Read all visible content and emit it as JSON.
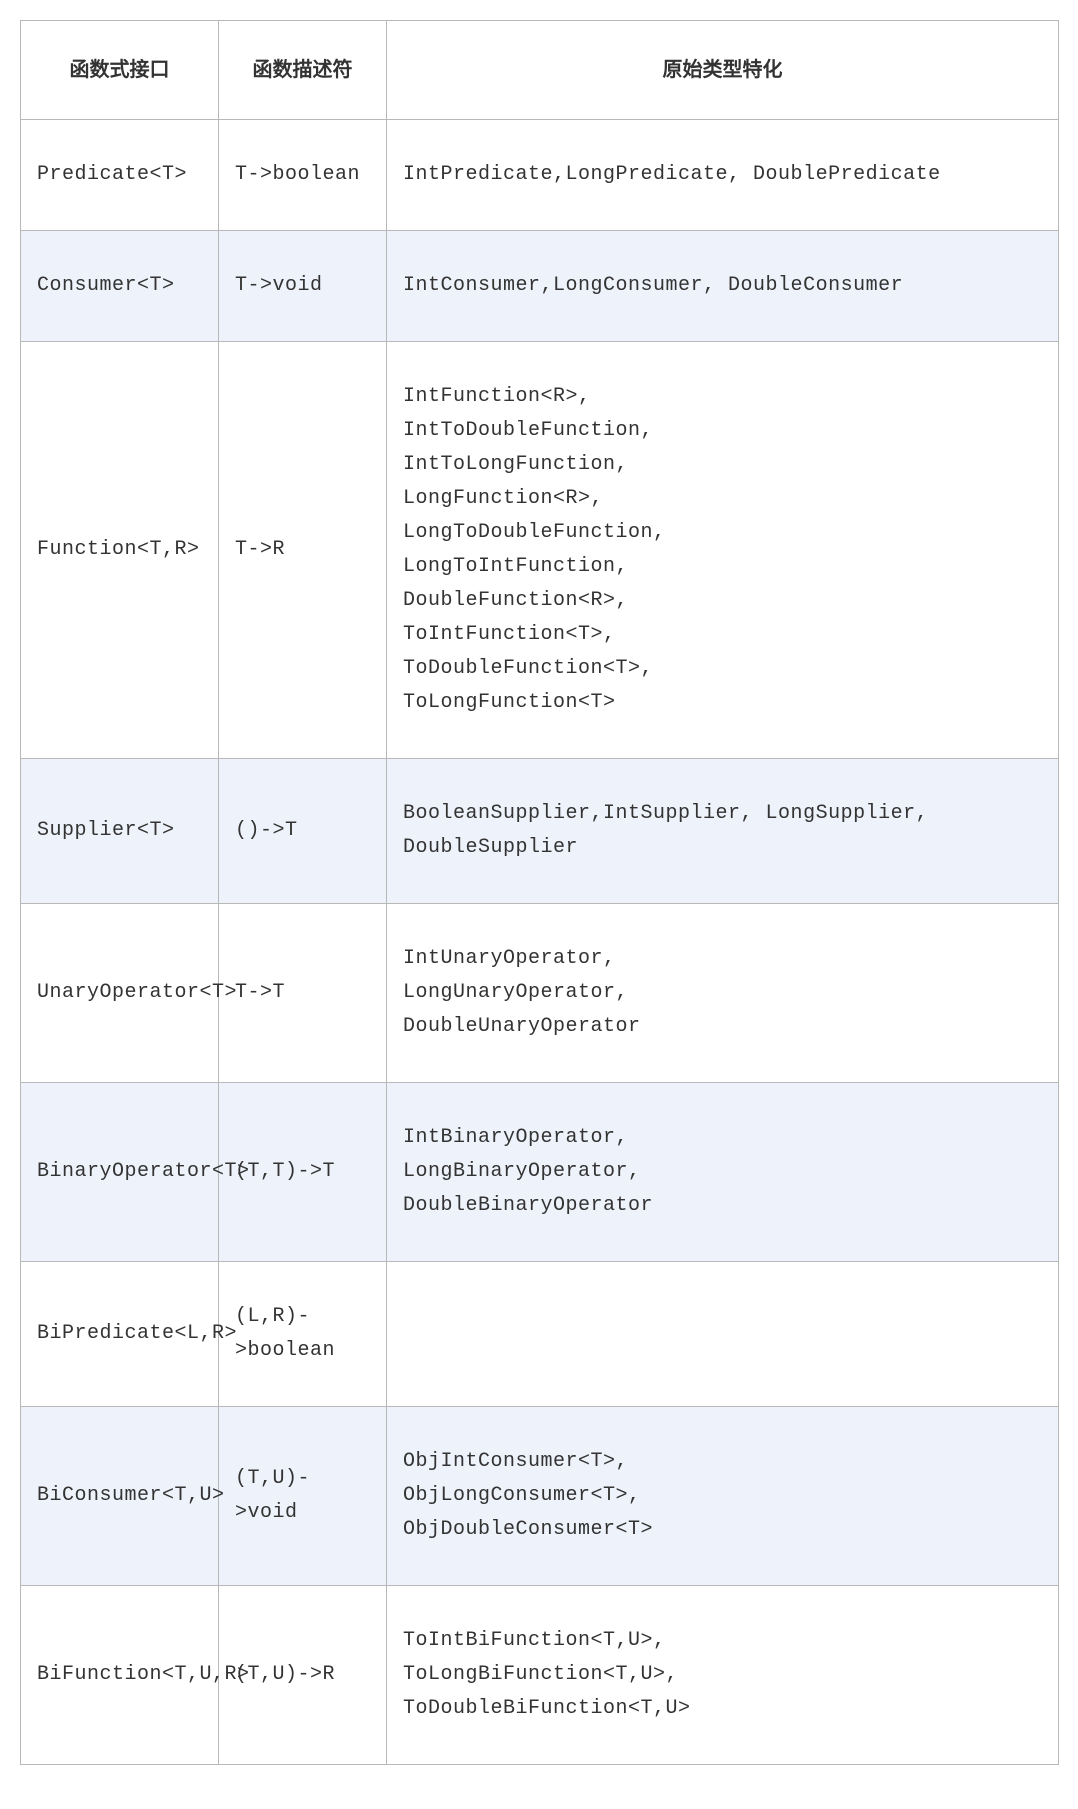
{
  "headers": {
    "interface": "函数式接口",
    "descriptor": "函数描述符",
    "specialization": "原始类型特化"
  },
  "rows": [
    {
      "interface": "Predicate<T>",
      "descriptor": "T->boolean",
      "specialization": "IntPredicate,LongPredicate, DoublePredicate",
      "striped": false
    },
    {
      "interface": "Consumer<T>",
      "descriptor": "T->void",
      "specialization": "IntConsumer,LongConsumer, DoubleConsumer",
      "striped": true
    },
    {
      "interface": "Function<T,R>",
      "descriptor": "T->R",
      "specialization": "IntFunction<R>,\nIntToDoubleFunction,\nIntToLongFunction,\nLongFunction<R>,\nLongToDoubleFunction,\nLongToIntFunction,\nDoubleFunction<R>,\nToIntFunction<T>,\nToDoubleFunction<T>,\nToLongFunction<T>",
      "striped": false
    },
    {
      "interface": "Supplier<T>",
      "descriptor": "()->T",
      "specialization": "BooleanSupplier,IntSupplier, LongSupplier, DoubleSupplier",
      "striped": true
    },
    {
      "interface": "UnaryOperator<T>",
      "descriptor": "T->T",
      "specialization": "IntUnaryOperator,\nLongUnaryOperator,\nDoubleUnaryOperator",
      "striped": false
    },
    {
      "interface": "BinaryOperator<T>",
      "descriptor": "(T,T)->T",
      "specialization": "IntBinaryOperator,\nLongBinaryOperator,\nDoubleBinaryOperator",
      "striped": true
    },
    {
      "interface": "BiPredicate<L,R>",
      "descriptor": "(L,R)->boolean",
      "specialization": "",
      "striped": false
    },
    {
      "interface": "BiConsumer<T,U>",
      "descriptor": "(T,U)->void",
      "specialization": "ObjIntConsumer<T>,\nObjLongConsumer<T>,\nObjDoubleConsumer<T>",
      "striped": true
    },
    {
      "interface": "BiFunction<T,U,R>",
      "descriptor": "(T,U)->R",
      "specialization": "ToIntBiFunction<T,U>,\nToLongBiFunction<T,U>,\nToDoubleBiFunction<T,U>",
      "striped": false
    }
  ]
}
